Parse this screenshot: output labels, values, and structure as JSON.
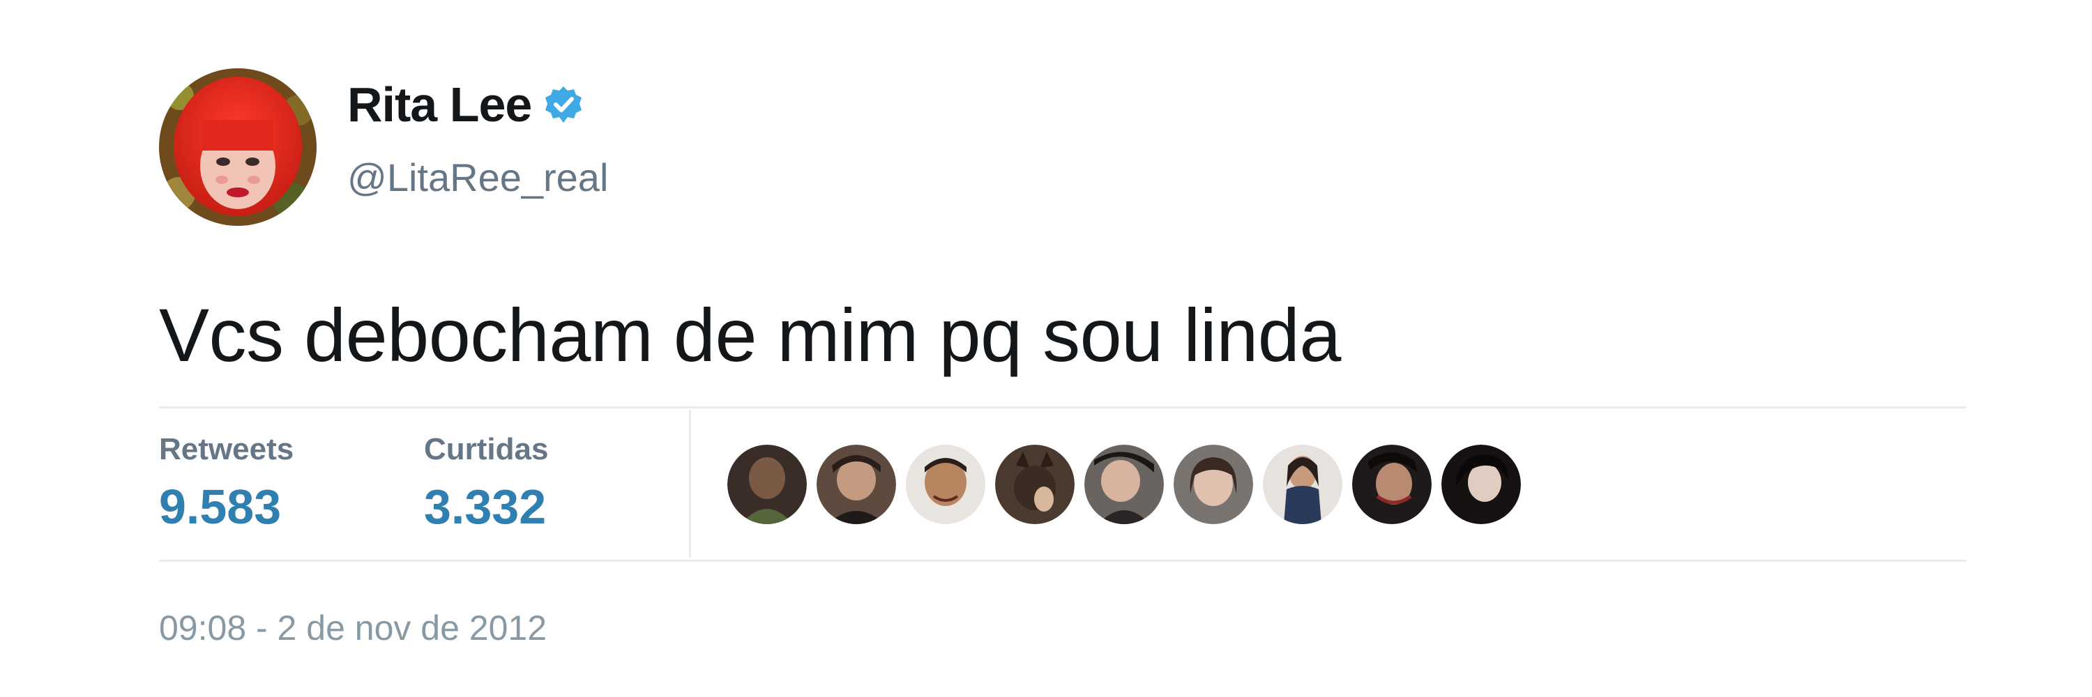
{
  "tweet": {
    "author": {
      "display_name": "Rita Lee",
      "handle": "@LitaRee_real",
      "verified": true,
      "avatar_icon": "profile-photo",
      "verified_icon": "verified-badge-icon"
    },
    "text": "Vcs debocham de mim pq sou linda",
    "stats": {
      "retweets_label": "Retweets",
      "retweets_value": "9.583",
      "likes_label": "Curtidas",
      "likes_value": "3.332"
    },
    "likers": [
      {
        "name": "liker-1"
      },
      {
        "name": "liker-2"
      },
      {
        "name": "liker-3"
      },
      {
        "name": "liker-4"
      },
      {
        "name": "liker-5"
      },
      {
        "name": "liker-6"
      },
      {
        "name": "liker-7"
      },
      {
        "name": "liker-8"
      },
      {
        "name": "liker-9"
      }
    ],
    "timestamp": "09:08 - 2 de nov de 2012"
  },
  "colors": {
    "text": "#14171a",
    "secondary": "#657786",
    "accent": "#2f7fb0",
    "verified": "#3fa9e6",
    "divider": "#e6ecf0"
  }
}
